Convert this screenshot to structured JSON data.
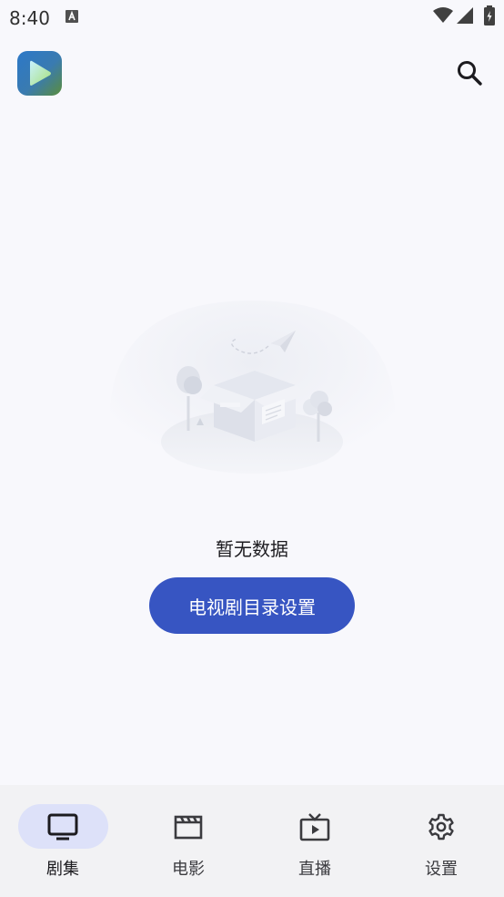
{
  "status_bar": {
    "time": "8:40",
    "icons": [
      "notification-a-icon",
      "wifi-icon",
      "signal-icon",
      "battery-icon"
    ]
  },
  "top_bar": {
    "logo_icon": "play-logo-icon",
    "search_icon": "search-icon"
  },
  "empty_state": {
    "illustration": "empty-box-illustration",
    "message": "暂无数据",
    "action_label": "电视剧目录设置"
  },
  "bottom_nav": {
    "items": [
      {
        "label": "剧集",
        "icon": "tv-icon",
        "active": true
      },
      {
        "label": "电影",
        "icon": "clapperboard-icon",
        "active": false
      },
      {
        "label": "直播",
        "icon": "live-tv-icon",
        "active": false
      },
      {
        "label": "设置",
        "icon": "gear-icon",
        "active": false
      }
    ]
  },
  "colors": {
    "background": "#f8f8fc",
    "primary_button": "#3755c2",
    "nav_background": "#f2f2f4",
    "nav_active_indicator": "#dde1f9"
  }
}
